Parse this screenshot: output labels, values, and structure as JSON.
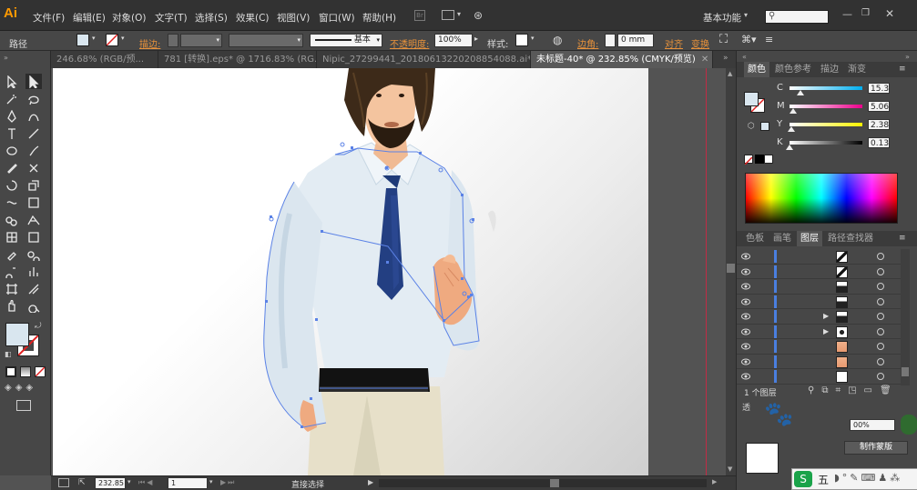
{
  "app": {
    "logo": "Ai",
    "workspace": "基本功能"
  },
  "menu": [
    "文件(F)",
    "编辑(E)",
    "对象(O)",
    "文字(T)",
    "选择(S)",
    "效果(C)",
    "视图(V)",
    "窗口(W)",
    "帮助(H)"
  ],
  "control": {
    "path_label": "路径",
    "stroke_label": "描边:",
    "stroke_style": "基本",
    "opacity_label": "不透明度:",
    "opacity_value": "100%",
    "style_label": "样式:",
    "corner_label": "边角:",
    "corner_value": "0 mm",
    "align_label": "对齐",
    "transform_label": "变换"
  },
  "tabs": [
    {
      "label": "246.68% (RGB/预..."
    },
    {
      "label": "781 [转换].eps* @ 1716.83% (RG..."
    },
    {
      "label": "Nipic_27299441_20180613220208854088.ai*"
    },
    {
      "label": "未标题-40* @ 232.85% (CMYK/预览)",
      "active": true
    }
  ],
  "status": {
    "zoom": "232.85",
    "page": "1",
    "tool": "直接选择"
  },
  "color_panel": {
    "tabs": [
      "颜色",
      "颜色参考",
      "描边",
      "渐变"
    ],
    "sliders": [
      {
        "label": "C",
        "value": "15.3",
        "pct": 15.3,
        "track": "linear-gradient(to right,#ffffff,#00aeef)"
      },
      {
        "label": "M",
        "value": "5.06",
        "pct": 5.06,
        "track": "linear-gradient(to right,#ffffff,#ec008c)"
      },
      {
        "label": "Y",
        "value": "2.38",
        "pct": 2.38,
        "track": "linear-gradient(to right,#ffffff,#fff200)"
      },
      {
        "label": "K",
        "value": "0.13",
        "pct": 0.13,
        "track": "linear-gradient(to right,#ffffff,#000000)"
      }
    ],
    "fill_color": "#d9e6ef"
  },
  "layers_panel": {
    "tabs": [
      "色板",
      "画笔",
      "图层",
      "路径查找器"
    ],
    "count_label": "1 个图层",
    "layers": [
      {
        "thumb": "stripe",
        "expand": false
      },
      {
        "thumb": "stripe",
        "expand": false
      },
      {
        "thumb": "dark",
        "expand": false
      },
      {
        "thumb": "dark",
        "expand": false
      },
      {
        "thumb": "dark",
        "expand": true
      },
      {
        "thumb": "eye",
        "expand": true
      },
      {
        "thumb": "skin",
        "expand": false
      },
      {
        "thumb": "skin",
        "expand": false
      },
      {
        "thumb": "white",
        "expand": false
      }
    ]
  },
  "transparency": {
    "opacity": "00%",
    "make_mask": "制作蒙版"
  },
  "ime": {
    "label": "五"
  }
}
